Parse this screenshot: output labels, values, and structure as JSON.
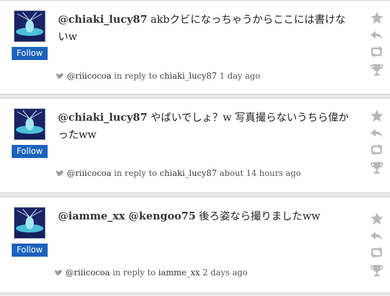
{
  "tweets": [
    {
      "mention": "@chiaki_lucy87",
      "text": " akbクビになっちゃうからここには書けないw",
      "follow_label": "Follow",
      "meta_user": "@riiicocoa",
      "meta_in_reply_to": " in reply to ",
      "meta_reply_user": "chiaki_lucy87",
      "meta_time": " 1 day ago"
    },
    {
      "mention": "@chiaki_lucy87",
      "text": " やばいでしょ？w 写真撮らないうちら偉かったww",
      "follow_label": "Follow",
      "meta_user": "@riiicocoa",
      "meta_in_reply_to": " in reply to ",
      "meta_reply_user": "chiaki_lucy87",
      "meta_time": " about 14 hours ago"
    },
    {
      "mention": "@iamme_xx @kengoo75",
      "text": " 後ろ姿なら撮りましたww",
      "follow_label": "Follow",
      "meta_user": "@riiicocoa",
      "meta_in_reply_to": " in reply to ",
      "meta_reply_user": "iamme_xx",
      "meta_time": " 2 days ago"
    }
  ],
  "actions": [
    "star-icon",
    "reply-icon",
    "retweet-icon",
    "trophy-icon"
  ],
  "colors": {
    "follow_bg": "#1d63bb",
    "icon_gray": "#b8b8b8",
    "background": "#e9e9e9"
  }
}
